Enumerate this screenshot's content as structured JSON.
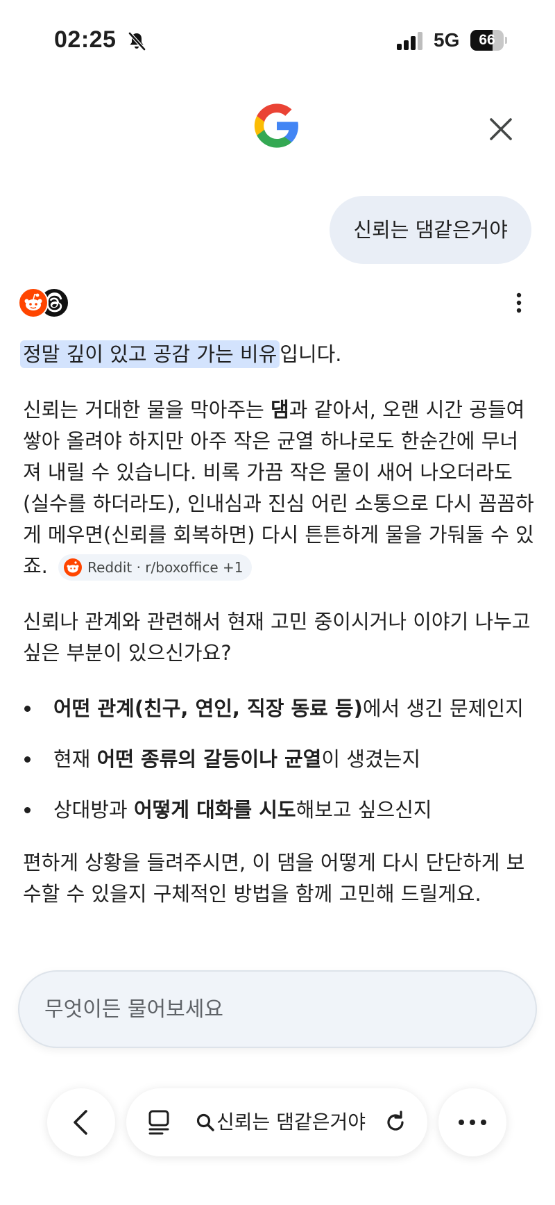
{
  "status_bar": {
    "time": "02:25",
    "network": "5G",
    "battery_level": "66",
    "battery_fraction": 0.66
  },
  "header": {
    "logo_icon": "google-g-icon",
    "close_icon": "close-icon"
  },
  "conversation": {
    "user_query": "신뢰는 댐같은거야",
    "sources": [
      "reddit-icon",
      "threads-icon"
    ],
    "answer": {
      "intro_highlight": "정말 깊이 있고 공감 가는 비유",
      "intro_rest": "입니다.",
      "p1_part1": "신뢰는 거대한 물을 막아주는 ",
      "p1_bold": "댐",
      "p1_part2": "과 같아서, 오랜 시간 공들여 쌓아 올려야 하지만 아주 작은 균열 하나로도 한순간에 무너져 내릴 수 있습니다. 비록 가끔 작은 물이 새어 나오더라도(실수를 하더라도), 인내심과 진심 어린 소통으로 다시 꼼꼼하게 메우면(신뢰를 회복하면) 다시 튼튼하게 물을 가둬둘 수 있죠.",
      "citation_chip": "Reddit · r/boxoffice +1",
      "p2": "신뢰나 관계와 관련해서 현재 고민 중이시거나 이야기 나누고 싶은 부분이 있으신가요?",
      "bullets": [
        {
          "pre": "",
          "bold": "어떤 관계(친구, 연인, 직장 동료 등)",
          "post": "에서 생긴 문제인지"
        },
        {
          "pre": "현재 ",
          "bold": "어떤 종류의 갈등이나 균열",
          "post": "이 생겼는지"
        },
        {
          "pre": "상대방과 ",
          "bold": "어떻게 대화를 시도",
          "post": "해보고 싶으신지"
        }
      ],
      "closing": "편하게 상황을 들려주시면, 이 댐을 어떻게 다시 단단하게 보수할 수 있을지 구체적인 방법을 함께 고민해 드릴게요."
    }
  },
  "input": {
    "placeholder": "무엇이든 물어보세요",
    "value": ""
  },
  "toolbar": {
    "back_icon": "chevron-left-icon",
    "tabs_icon": "tabs-icon",
    "search_icon": "search-icon",
    "query": "신뢰는 댐같은거야",
    "reload_icon": "reload-icon",
    "more_icon": "more-horizontal-icon"
  },
  "colors": {
    "highlight": "#d3e3fd",
    "user_bubble": "#e9eef6",
    "input_bg": "#f0f4f9",
    "reddit": "#ff4500",
    "text": "#1f1f1f"
  }
}
